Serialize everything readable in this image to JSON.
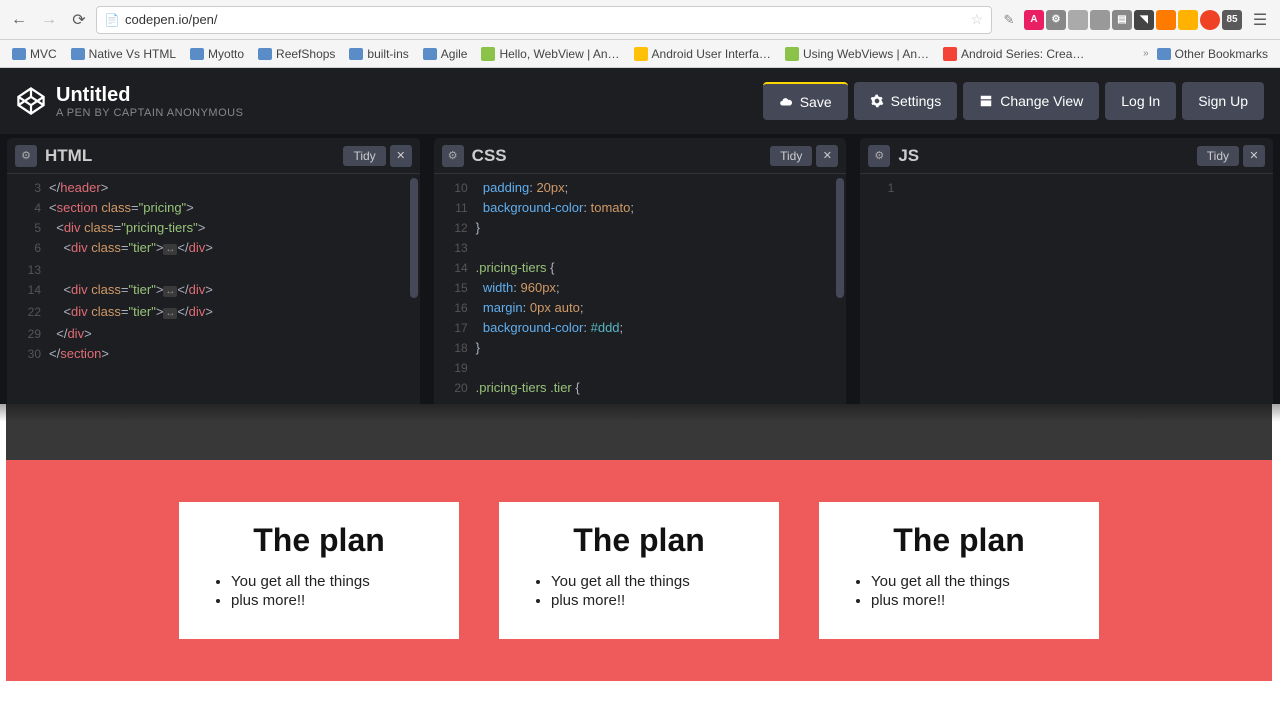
{
  "browser": {
    "url": "codepen.io/pen/",
    "bookmarks": [
      "MVC",
      "Native Vs HTML",
      "Myotto",
      "ReefShops",
      "built-ins",
      "Agile",
      "Hello, WebView | An…",
      "Android User Interfa…",
      "Using WebViews | An…",
      "Android Series: Crea…"
    ],
    "other_label": "Other Bookmarks",
    "ext_badge": "85"
  },
  "header": {
    "title": "Untitled",
    "subtitle": "A PEN BY CAPTAIN ANONYMOUS",
    "buttons": {
      "save": "Save",
      "settings": "Settings",
      "change_view": "Change View",
      "login": "Log In",
      "signup": "Sign Up"
    }
  },
  "panels": {
    "html": {
      "title": "HTML",
      "tidy": "Tidy"
    },
    "css": {
      "title": "CSS",
      "tidy": "Tidy"
    },
    "js": {
      "title": "JS",
      "tidy": "Tidy"
    }
  },
  "html_lines": {
    "l3": "3",
    "l4": "4",
    "l5": "5",
    "l6": "6",
    "l13": "13",
    "l14": "14",
    "l22": "22",
    "l29": "29",
    "l30": "30"
  },
  "css_lines": {
    "l10": "10",
    "l11": "11",
    "l12": "12",
    "l13": "13",
    "l14": "14",
    "l15": "15",
    "l16": "16",
    "l17": "17",
    "l18": "18",
    "l19": "19",
    "l20": "20"
  },
  "js_lines": {
    "l1": "1"
  },
  "preview": {
    "plan_title": "The plan",
    "bullet1": "You get all the things",
    "bullet2": "plus more!!"
  }
}
